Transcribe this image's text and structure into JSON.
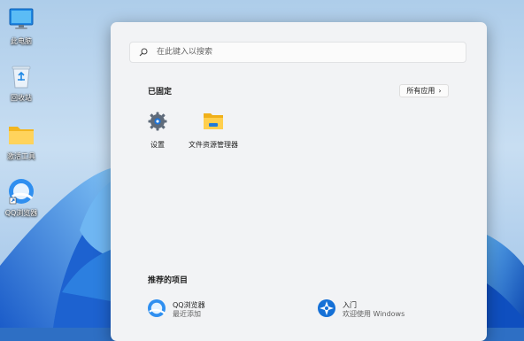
{
  "desktop": {
    "icons": [
      {
        "label": "此电脑",
        "icon": "computer-icon"
      },
      {
        "label": "回收站",
        "icon": "recycle-bin-icon"
      },
      {
        "label": "激活工具",
        "icon": "folder-icon"
      },
      {
        "label": "QQ浏览器",
        "icon": "qq-browser-icon"
      }
    ]
  },
  "start_menu": {
    "search": {
      "placeholder": "在此键入以搜索",
      "value": ""
    },
    "pinned": {
      "title": "已固定",
      "all_apps_label": "所有应用",
      "apps": [
        {
          "label": "设置",
          "icon": "settings-gear-icon"
        },
        {
          "label": "文件资源管理器",
          "icon": "file-explorer-icon"
        }
      ]
    },
    "recommended": {
      "title": "推荐的项目",
      "items": [
        {
          "name": "QQ浏览器",
          "subtitle": "最近添加",
          "icon": "qq-browser-icon"
        },
        {
          "name": "入门",
          "subtitle": "欢迎使用 Windows",
          "icon": "get-started-icon"
        }
      ]
    }
  },
  "colors": {
    "wallpaper_base": "#2e6fc4",
    "wallpaper_light": "#c5dcf3",
    "menu_background": "#f2f3f5",
    "accent": "#0a64c8"
  }
}
